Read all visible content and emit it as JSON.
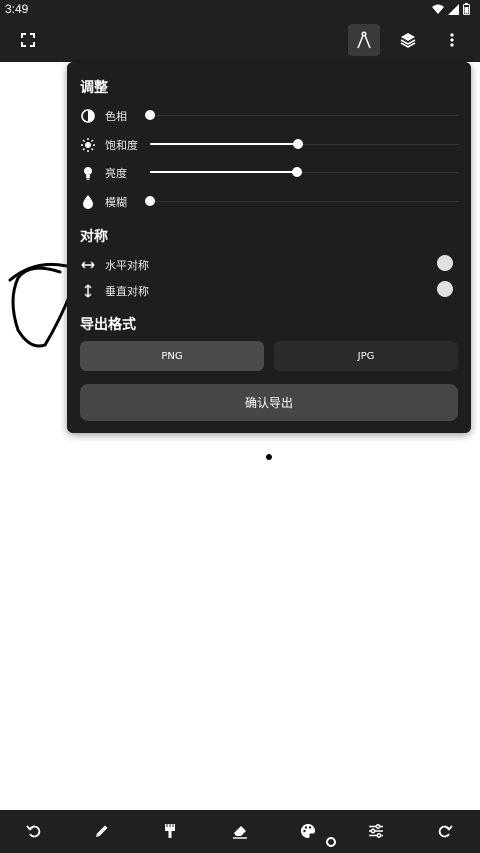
{
  "status_bar": {
    "time": "3:49"
  },
  "toolbar": {
    "fullscreen_icon": "fullscreen-icon",
    "compass_icon": "compass-icon",
    "layers_icon": "layers-icon",
    "more_icon": "more-vert-icon"
  },
  "panel": {
    "adjust_title": "调整",
    "adjust_rows": [
      {
        "label": "色相",
        "icon": "contrast-icon",
        "value": 0.0
      },
      {
        "label": "饱和度",
        "icon": "sun-icon",
        "value": 0.5
      },
      {
        "label": "亮度",
        "icon": "lightbulb-icon",
        "value": 0.5
      },
      {
        "label": "模糊",
        "icon": "drop-icon",
        "value": 0.0
      }
    ],
    "symmetry_title": "对称",
    "symmetry_rows": [
      {
        "label": "水平对称",
        "icon": "horizontal-arrows-icon"
      },
      {
        "label": "垂直对称",
        "icon": "vertical-arrows-icon"
      }
    ],
    "export_format_title": "导出格式",
    "formats": [
      "PNG",
      "JPG"
    ],
    "selected_format": "PNG",
    "confirm_export_label": "确认导出"
  },
  "bottom_toolbar": {
    "tools": [
      "undo-icon",
      "pencil-icon",
      "brush-icon",
      "eraser-icon",
      "palette-icon",
      "sliders-icon",
      "redo-icon"
    ]
  },
  "colors": {
    "bar_bg": "#202020",
    "panel_bg": "#1e1e1e",
    "canvas_bg": "#ffffff",
    "stroke": "#000000"
  }
}
